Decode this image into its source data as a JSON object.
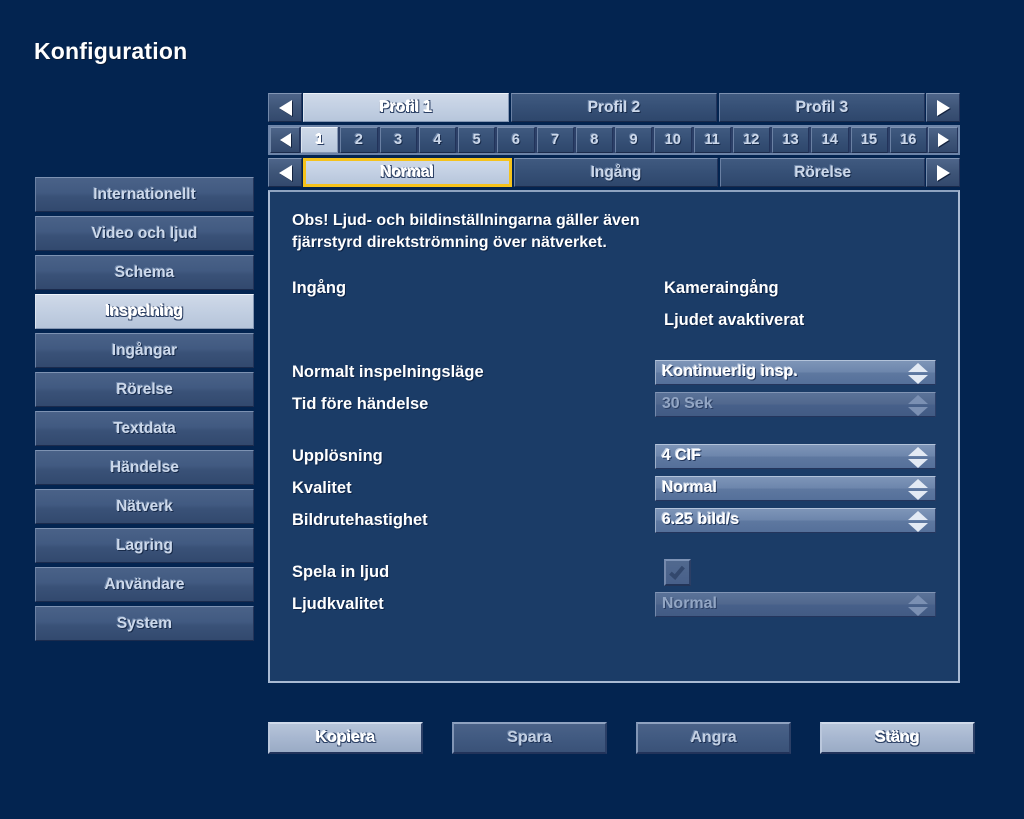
{
  "page_title": "Konfiguration",
  "colors": {
    "background": "#032450",
    "panel_bg": "#1b3c67",
    "accent_focus": "#f5c21b",
    "selected_bg": "#c3d0e3",
    "item_bg": "#3a5278"
  },
  "sidebar": {
    "items": [
      {
        "label": "Internationellt",
        "selected": false
      },
      {
        "label": "Video och ljud",
        "selected": false
      },
      {
        "label": "Schema",
        "selected": false
      },
      {
        "label": "Inspelning",
        "selected": true
      },
      {
        "label": "Ingångar",
        "selected": false
      },
      {
        "label": "Rörelse",
        "selected": false
      },
      {
        "label": "Textdata",
        "selected": false
      },
      {
        "label": "Händelse",
        "selected": false
      },
      {
        "label": "Nätverk",
        "selected": false
      },
      {
        "label": "Lagring",
        "selected": false
      },
      {
        "label": "Användare",
        "selected": false
      },
      {
        "label": "System",
        "selected": false
      }
    ]
  },
  "profile_tabs": {
    "prev_icon": "triangle-left-icon",
    "next_icon": "triangle-right-icon",
    "items": [
      {
        "label": "Profil 1",
        "active": true
      },
      {
        "label": "Profil 2",
        "active": false
      },
      {
        "label": "Profil 3",
        "active": false
      }
    ]
  },
  "channel_tabs": {
    "prev_icon": "triangle-left-icon",
    "next_icon": "triangle-right-icon",
    "items": [
      {
        "label": "1",
        "active": true
      },
      {
        "label": "2",
        "active": false
      },
      {
        "label": "3",
        "active": false
      },
      {
        "label": "4",
        "active": false
      },
      {
        "label": "5",
        "active": false
      },
      {
        "label": "6",
        "active": false
      },
      {
        "label": "7",
        "active": false
      },
      {
        "label": "8",
        "active": false
      },
      {
        "label": "9",
        "active": false
      },
      {
        "label": "10",
        "active": false
      },
      {
        "label": "11",
        "active": false
      },
      {
        "label": "12",
        "active": false
      },
      {
        "label": "13",
        "active": false
      },
      {
        "label": "14",
        "active": false
      },
      {
        "label": "15",
        "active": false
      },
      {
        "label": "16",
        "active": false
      }
    ]
  },
  "mode_tabs": {
    "prev_icon": "triangle-left-icon",
    "next_icon": "triangle-right-icon",
    "items": [
      {
        "label": "Normal",
        "active": true,
        "focused": true
      },
      {
        "label": "Ingång",
        "active": false,
        "focused": false
      },
      {
        "label": "Rörelse",
        "active": false,
        "focused": false
      }
    ]
  },
  "content": {
    "notice_line1": "Obs! Ljud- och bildinställningarna gäller även",
    "notice_line2": "fjärrstyrd direktströmning över nätverket.",
    "input_label": "Ingång",
    "input_value": "Kameraingång",
    "audio_status": "Ljudet avaktiverat",
    "fields": [
      {
        "label": "Normalt inspelningsläge",
        "value": "Kontinuerlig insp.",
        "type": "spinner",
        "disabled": false
      },
      {
        "label": "Tid före händelse",
        "value": "30 Sek",
        "type": "spinner",
        "disabled": true
      },
      {
        "label": "Upplösning",
        "value": "4 CIF",
        "type": "spinner",
        "disabled": false
      },
      {
        "label": "Kvalitet",
        "value": "Normal",
        "type": "spinner",
        "disabled": false
      },
      {
        "label": "Bildrutehastighet",
        "value": "6.25 bild/s",
        "type": "spinner",
        "disabled": false
      },
      {
        "label": "Spela in ljud",
        "value": "",
        "type": "checkbox",
        "checked": true,
        "disabled": true
      },
      {
        "label": "Ljudkvalitet",
        "value": "Normal",
        "type": "spinner",
        "disabled": true
      }
    ]
  },
  "buttons": [
    {
      "label": "Kopiera",
      "style": "light"
    },
    {
      "label": "Spara",
      "style": "dark"
    },
    {
      "label": "Angra",
      "style": "dark"
    },
    {
      "label": "Stäng",
      "style": "light"
    }
  ]
}
